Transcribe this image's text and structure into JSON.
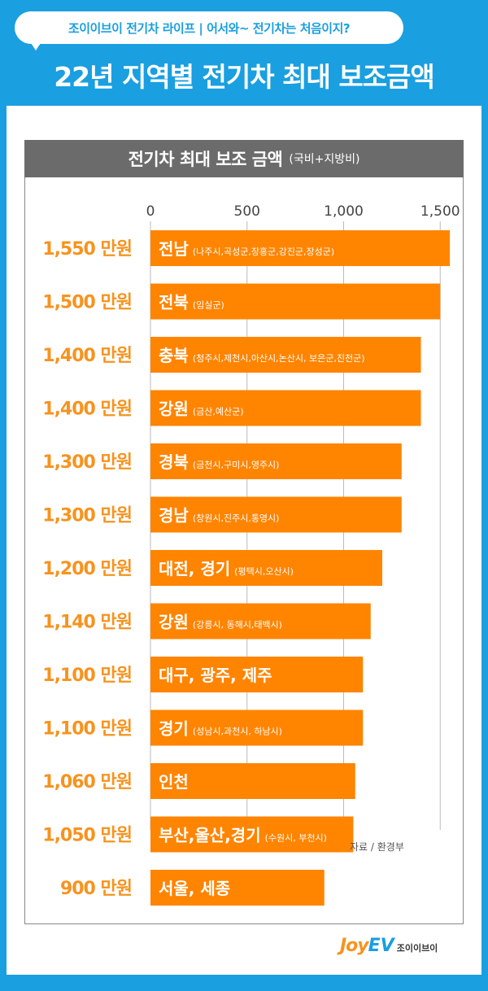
{
  "header": {
    "tag_text": "조이이브이 전기차 라이프 | 어서와~ 전기차는 처음이지?",
    "title": "22년 지역별 전기차 최대 보조금액"
  },
  "chart_data": {
    "type": "bar",
    "orientation": "horizontal",
    "title": "전기차 최대 보조 금액",
    "subtitle": "(국비+지방비)",
    "xlim": [
      0,
      1650
    ],
    "x_ticks": [
      "0",
      "500",
      "1,000",
      "1,500"
    ],
    "x_tick_values": [
      0,
      500,
      1000,
      1500
    ],
    "values": [
      1550,
      1500,
      1400,
      1400,
      1300,
      1300,
      1200,
      1140,
      1100,
      1100,
      1060,
      1050,
      900
    ],
    "value_labels": [
      "1,550 만원",
      "1,500 만원",
      "1,400 만원",
      "1,400 만원",
      "1,300 만원",
      "1,300 만원",
      "1,200 만원",
      "1,140 만원",
      "1,100 만원",
      "1,100 만원",
      "1,060 만원",
      "1,050 만원",
      "900 만원"
    ],
    "regions": [
      "전남",
      "전북",
      "충북",
      "강원",
      "경북",
      "경남",
      "대전, 경기",
      "강원",
      "대구, 광주, 제주",
      "경기",
      "인천",
      "부산,울산,경기",
      "서울, 세종"
    ],
    "region_details": [
      "(나주시,곡성군,장흥군,강진군,장성군)",
      "(임실군)",
      "(청주시,제천시,아산시,논산시, 보은군,진천군)",
      "(금산,예산군)",
      "(금천시,구미시,영주시)",
      "(창원시,진주시,통영시)",
      "(평택시,오산시)",
      "(강릉시, 동해시,태백시)",
      "",
      "(성남시,과천시, 하남시)",
      "",
      "(수원시, 부천시)",
      ""
    ],
    "source": "자료 / 환경부",
    "grid": true
  },
  "brand": {
    "logo_joy": "Joy",
    "logo_ev": "EV",
    "logo_kr": "조이이브이"
  },
  "colors": {
    "background": "#1a9fe0",
    "bar": "#ff8400",
    "label": "#f7931e",
    "title_box": "#6b6b6b",
    "grid": "#bbbbbb"
  }
}
